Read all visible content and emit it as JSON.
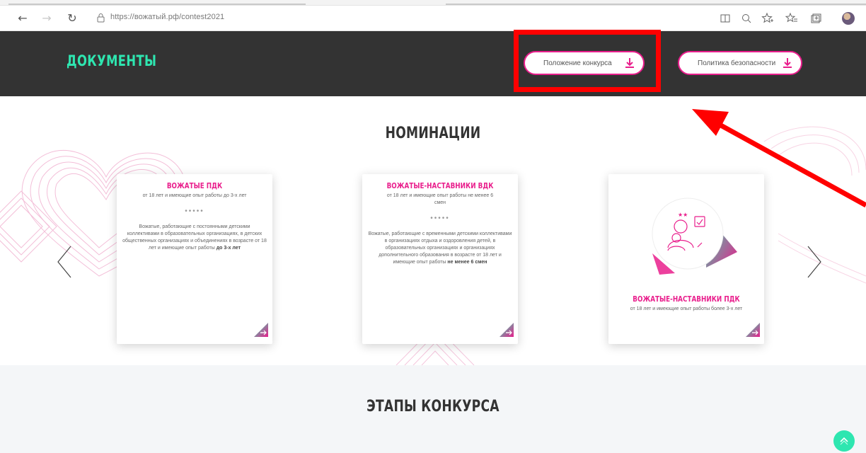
{
  "browser": {
    "back_glyph": "←",
    "forward_glyph": "→",
    "refresh_glyph": "↻",
    "url": "https://вожатый.рф/contest2021",
    "icons": [
      "reader-mode-icon",
      "zoom-icon",
      "favorite-add-icon",
      "favorites-icon",
      "collections-icon",
      "profile-avatar"
    ]
  },
  "docs": {
    "title": "ДОКУМЕНТЫ",
    "buttons": [
      {
        "label": "Положение конкурса"
      },
      {
        "label": "Политика безопасности"
      }
    ]
  },
  "nominations": {
    "title": "НОМИНАЦИИ",
    "cards": [
      {
        "title": "ВОЖАТЫЕ ПДК",
        "subtitle": "от 18 лет и имеющие опыт работы до 3-х лет",
        "dots": "•••••",
        "description": "Вожатые, работающие с постоянными детскими коллективами в образовательных организациях, в детских общественных организациях и объединениях в возрасте от 18 лет и имеющие опыт работы",
        "description_bold": "до 3-х лет"
      },
      {
        "title": "ВОЖАТЫЕ-НАСТАВНИКИ ВДК",
        "subtitle": "от 18 лет и имеющие опыт работы не менее 6 смен",
        "dots": "•••••",
        "description": "Вожатые, работающие с временными детскими коллективами в организациях отдыха и оздоровления детей, в образовательных организациях и организациях дополнительного образования в возрасте от 18 лет и имеющие опыт работы",
        "description_bold": "не менее 6 смен"
      },
      {
        "title": "ВОЖАТЫЕ-НАСТАВНИКИ ПДК",
        "subtitle": "от 18 лет и имеющие опыт работы более 3-х лет"
      }
    ]
  },
  "stages": {
    "title": "ЭТАПЫ КОНКУРСА"
  },
  "colors": {
    "accent_pink": "#e91e8c",
    "accent_teal": "#2ee6b0",
    "header_bg": "#333333",
    "annotation_red": "#ff0000"
  }
}
